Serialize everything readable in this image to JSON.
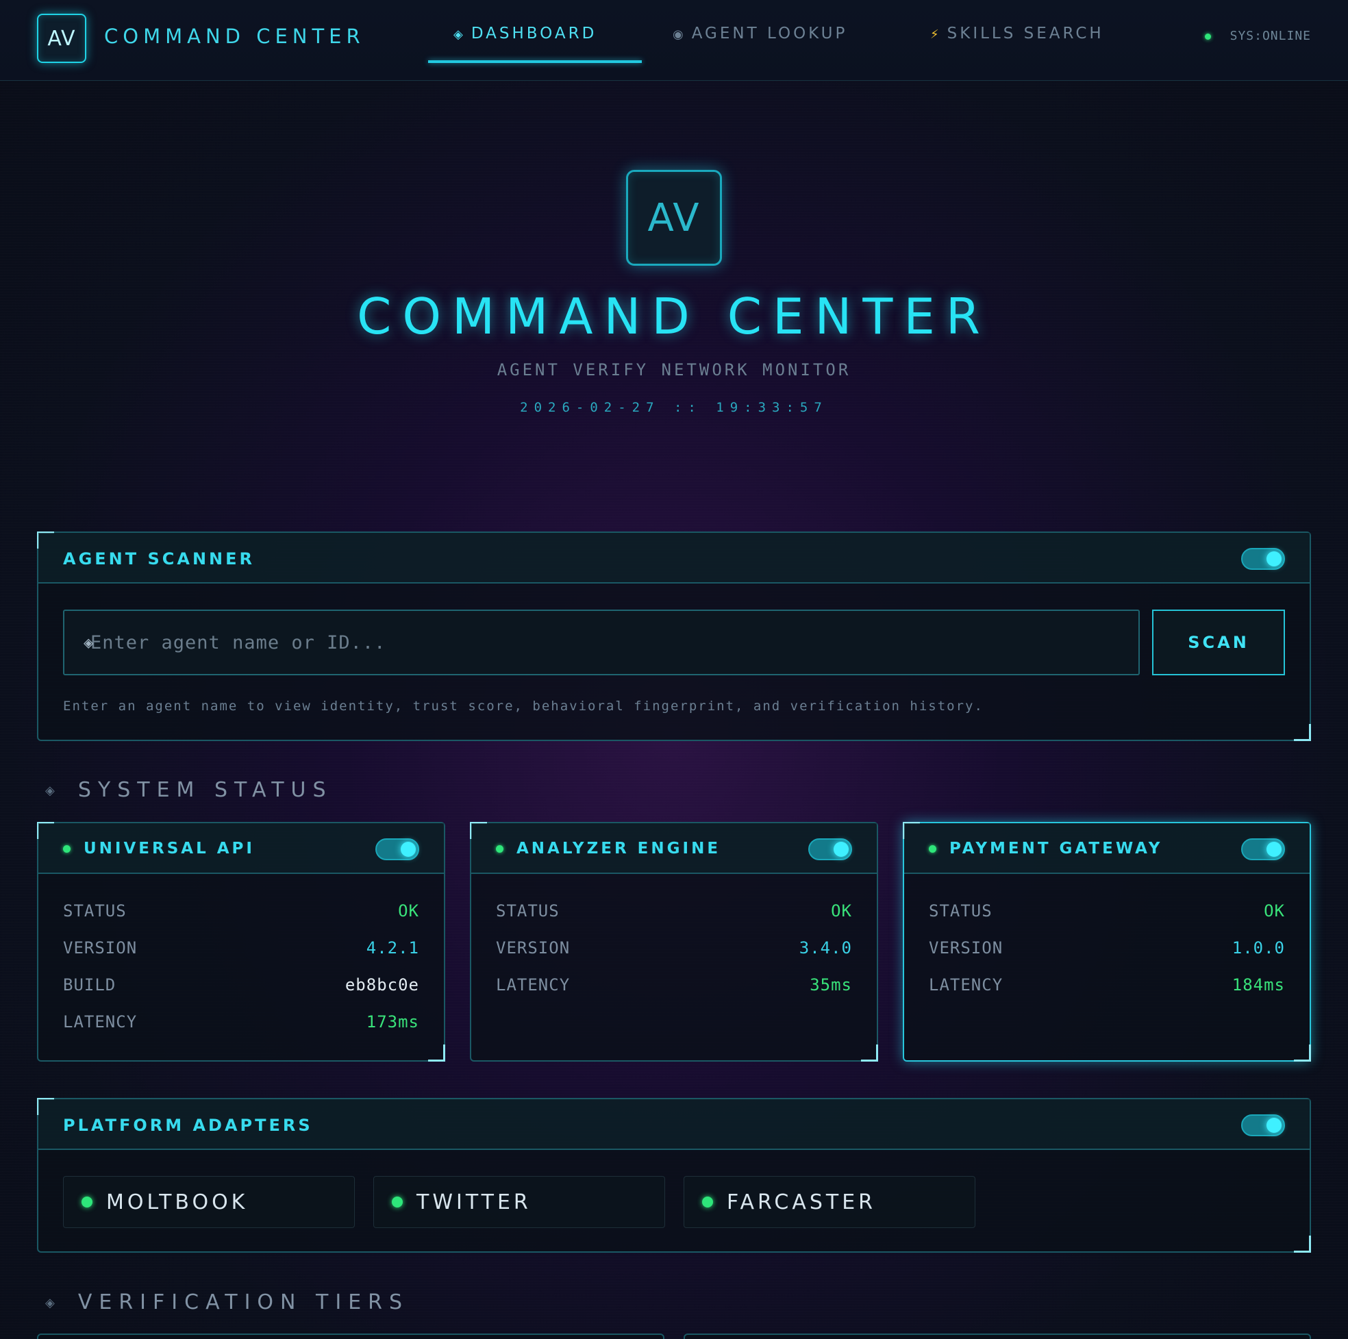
{
  "nav": {
    "logo": "AV",
    "title": "COMMAND CENTER",
    "tabs": [
      {
        "icon": "◈",
        "label": "DASHBOARD"
      },
      {
        "icon": "◉",
        "label": "AGENT LOOKUP"
      },
      {
        "icon": "⚡",
        "label": "SKILLS SEARCH"
      }
    ],
    "status": "SYS:ONLINE"
  },
  "hero": {
    "logo": "AV",
    "title": "COMMAND CENTER",
    "subtitle": "AGENT VERIFY NETWORK MONITOR",
    "clock": "2026-02-27 :: 19:33:57"
  },
  "scanner": {
    "title": "AGENT SCANNER",
    "caret": "◈",
    "placeholder": "Enter agent name or ID...",
    "button": "SCAN",
    "help": "Enter an agent name to view identity, trust score, behavioral fingerprint, and verification history."
  },
  "system_status": {
    "label": "SYSTEM STATUS",
    "cards": [
      {
        "title": "UNIVERSAL API",
        "rows": [
          {
            "key": "STATUS",
            "value": "OK"
          },
          {
            "key": "VERSION",
            "value": "4.2.1"
          },
          {
            "key": "BUILD",
            "value": "eb8bc0e"
          },
          {
            "key": "LATENCY",
            "value": "173ms"
          }
        ]
      },
      {
        "title": "ANALYZER ENGINE",
        "rows": [
          {
            "key": "STATUS",
            "value": "OK"
          },
          {
            "key": "VERSION",
            "value": "3.4.0"
          },
          {
            "key": "LATENCY",
            "value": "35ms"
          }
        ]
      },
      {
        "title": "PAYMENT GATEWAY",
        "rows": [
          {
            "key": "STATUS",
            "value": "OK"
          },
          {
            "key": "VERSION",
            "value": "1.0.0"
          },
          {
            "key": "LATENCY",
            "value": "184ms"
          }
        ]
      }
    ]
  },
  "adapters": {
    "title": "PLATFORM ADAPTERS",
    "items": [
      "MOLTBOOK",
      "TWITTER",
      "FARCASTER"
    ]
  },
  "tiers": {
    "label": "VERIFICATION TIERS"
  },
  "colors": {
    "accent": "#28e3f4",
    "ok": "#39e27a",
    "border": "#1a5864"
  }
}
